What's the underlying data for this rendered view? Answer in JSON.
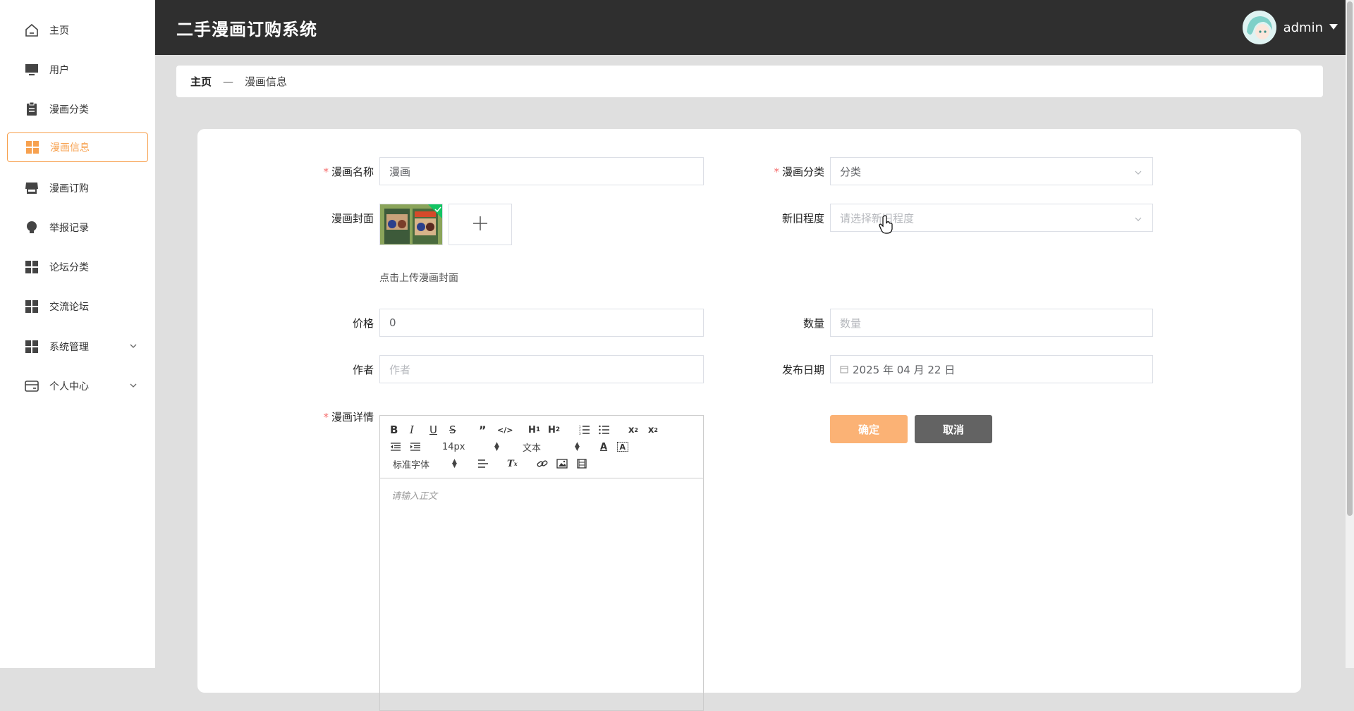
{
  "header": {
    "title": "二手漫画订购系统",
    "user_name": "admin"
  },
  "sidebar": {
    "items": [
      {
        "label": "主页",
        "icon": "home-icon"
      },
      {
        "label": "用户",
        "icon": "monitor-icon"
      },
      {
        "label": "漫画分类",
        "icon": "clipboard-icon"
      },
      {
        "label": "漫画信息",
        "icon": "grid-icon",
        "active": true
      },
      {
        "label": "漫画订购",
        "icon": "shop-icon"
      },
      {
        "label": "举报记录",
        "icon": "bulb-icon"
      },
      {
        "label": "论坛分类",
        "icon": "grid-icon"
      },
      {
        "label": "交流论坛",
        "icon": "grid-icon"
      },
      {
        "label": "系统管理",
        "icon": "grid-icon",
        "expandable": true
      },
      {
        "label": "个人中心",
        "icon": "card-icon",
        "expandable": true
      }
    ]
  },
  "breadcrumb": {
    "home": "主页",
    "separator": "—",
    "current": "漫画信息"
  },
  "form": {
    "name": {
      "label": "漫画名称",
      "value": "漫画"
    },
    "category": {
      "label": "漫画分类",
      "value": "分类"
    },
    "cover": {
      "label": "漫画封面",
      "hint": "点击上传漫画封面"
    },
    "condition": {
      "label": "新旧程度",
      "placeholder": "请选择新旧程度"
    },
    "price": {
      "label": "价格",
      "value": "0"
    },
    "quantity": {
      "label": "数量",
      "placeholder": "数量"
    },
    "author": {
      "label": "作者",
      "placeholder": "作者"
    },
    "publish_date": {
      "label": "发布日期",
      "value": "2025 年 04 月 22 日"
    },
    "detail": {
      "label": "漫画详情",
      "font_size": "14px",
      "text_style": "文本",
      "font_family": "标准字体",
      "placeholder": "请输入正文"
    }
  },
  "buttons": {
    "confirm": "确定",
    "cancel": "取消"
  },
  "colors": {
    "accent": "#f7a14f",
    "header_bg": "#2f2f2f",
    "required": "#f56c6c",
    "confirm_bg": "#fbb275",
    "cancel_bg": "#636363"
  }
}
